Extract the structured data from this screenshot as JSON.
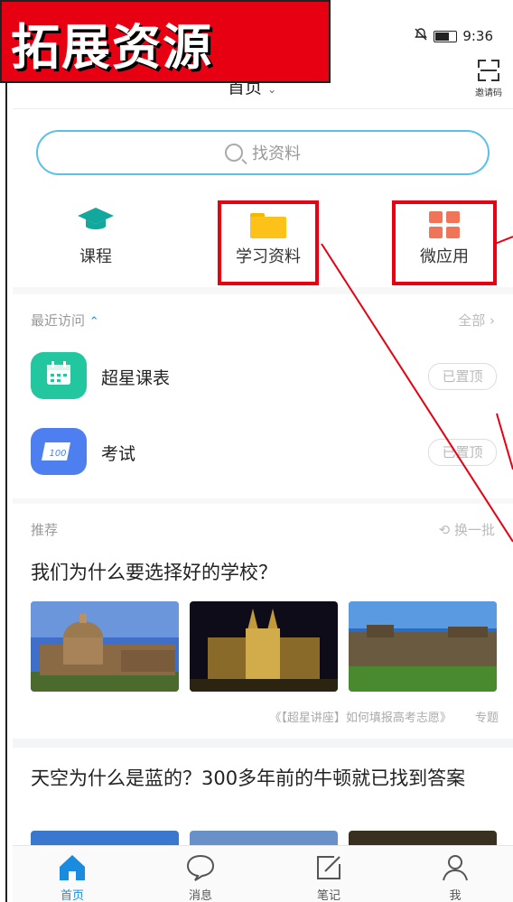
{
  "banner": {
    "text": "拓展资源"
  },
  "status": {
    "time": "9:36"
  },
  "header": {
    "title": "首页",
    "invite_label": "邀请码"
  },
  "search": {
    "placeholder": "找资料"
  },
  "quick_actions": [
    {
      "label": "课程",
      "icon": "graduation-cap-icon",
      "color": "#13a89e"
    },
    {
      "label": "学习资料",
      "icon": "folder-icon",
      "color": "#fdc21a"
    },
    {
      "label": "微应用",
      "icon": "apps-grid-icon",
      "color": "#f07558"
    }
  ],
  "recent": {
    "title": "最近访问",
    "more": "全部",
    "items": [
      {
        "name": "超星课表",
        "pin": "已置顶",
        "icon": "calendar-icon",
        "color": "#22c7a0"
      },
      {
        "name": "考试",
        "pin": "已置顶",
        "icon": "exam-100-icon",
        "color": "#4d7ff0",
        "icon_text": "100"
      }
    ]
  },
  "recommend": {
    "title": "推荐",
    "refresh": "换一批",
    "articles": [
      {
        "title": "我们为什么要选择好的学校？",
        "source": "《【超星讲座】如何填报高考志愿》",
        "tag": "专题"
      },
      {
        "title": "天空为什么是蓝的？300多年前的牛顿就已找到答案"
      }
    ]
  },
  "tabs": [
    {
      "label": "首页",
      "icon": "home-icon",
      "active": true
    },
    {
      "label": "消息",
      "icon": "message-icon"
    },
    {
      "label": "笔记",
      "icon": "note-edit-icon"
    },
    {
      "label": "我",
      "icon": "profile-icon"
    }
  ],
  "colors": {
    "accent": "#1a8ce0",
    "annotation": "#e60012",
    "search_border": "#5bbfe6"
  }
}
